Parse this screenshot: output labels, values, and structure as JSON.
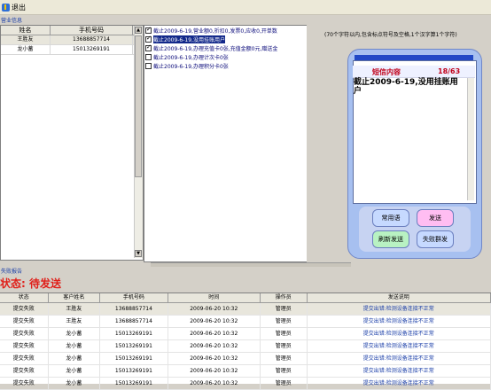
{
  "toolbar": {
    "exit_label": "退出"
  },
  "business": {
    "section_title": "营业信息",
    "columns": [
      "姓名",
      "手机号码"
    ],
    "rows": [
      {
        "name": "王胜友",
        "phone": "13688857714"
      },
      {
        "name": "龙小蓄",
        "phone": "15013269191"
      }
    ]
  },
  "messages": [
    {
      "checked": true,
      "text": "截止2009-6-19,营业额0,折扣0,发票0,应收0,开单数",
      "highlight": false
    },
    {
      "checked": true,
      "text": "截止2009-6-19,没用挂账用户",
      "highlight": true
    },
    {
      "checked": true,
      "text": "截止2009-6-19,办理充值卡0张,充值金额0元,赠送金",
      "highlight": false
    },
    {
      "checked": false,
      "text": "截止2009-6-19,办理计次卡0张",
      "highlight": false
    },
    {
      "checked": false,
      "text": "截止2009-6-19,办理积分卡0张",
      "highlight": false
    }
  ],
  "hint": "(70个字符以内,包含标点符号及空格,1个汉字算1个字符)",
  "phone": {
    "header": "短信内容",
    "count": "18/63",
    "content": "截止2009-6-19,没用挂账用户",
    "buttons": {
      "phrases": "常用语",
      "send": "发送",
      "resend": "刷新发送",
      "group": "失败群发"
    }
  },
  "failure": {
    "section_title": "失败报告",
    "status": "状态: 待发送",
    "columns": [
      "状态",
      "客户姓名",
      "手机号码",
      "时间",
      "操作员",
      "发送说明"
    ],
    "rows": [
      {
        "status": "提交失败",
        "name": "王胜友",
        "phone": "13688857714",
        "time": "2009-06-20 10:32",
        "op": "管理员",
        "desc": "提交出错:检测设备连接不正常"
      },
      {
        "status": "提交失败",
        "name": "王胜友",
        "phone": "13688857714",
        "time": "2009-06-20 10:32",
        "op": "管理员",
        "desc": "提交出错:检测设备连接不正常"
      },
      {
        "status": "提交失败",
        "name": "龙小蓄",
        "phone": "15013269191",
        "time": "2009-06-20 10:32",
        "op": "管理员",
        "desc": "提交出错:检测设备连接不正常"
      },
      {
        "status": "提交失败",
        "name": "龙小蓄",
        "phone": "15013269191",
        "time": "2009-06-20 10:32",
        "op": "管理员",
        "desc": "提交出错:检测设备连接不正常"
      },
      {
        "status": "提交失败",
        "name": "龙小蓄",
        "phone": "15013269191",
        "time": "2009-06-20 10:32",
        "op": "管理员",
        "desc": "提交出错:检测设备连接不正常"
      },
      {
        "status": "提交失败",
        "name": "龙小蓄",
        "phone": "15013269191",
        "time": "2009-06-20 10:32",
        "op": "管理员",
        "desc": "提交出错:检测设备连接不正常"
      },
      {
        "status": "提交失败",
        "name": "龙小蓄",
        "phone": "15013269191",
        "time": "2009-06-20 10:32",
        "op": "管理员",
        "desc": "提交出错:检测设备连接不正常"
      }
    ]
  },
  "colors": {
    "status_red": "#e0201a",
    "link_blue": "#1a3ea8",
    "highlight": "#12288a"
  }
}
